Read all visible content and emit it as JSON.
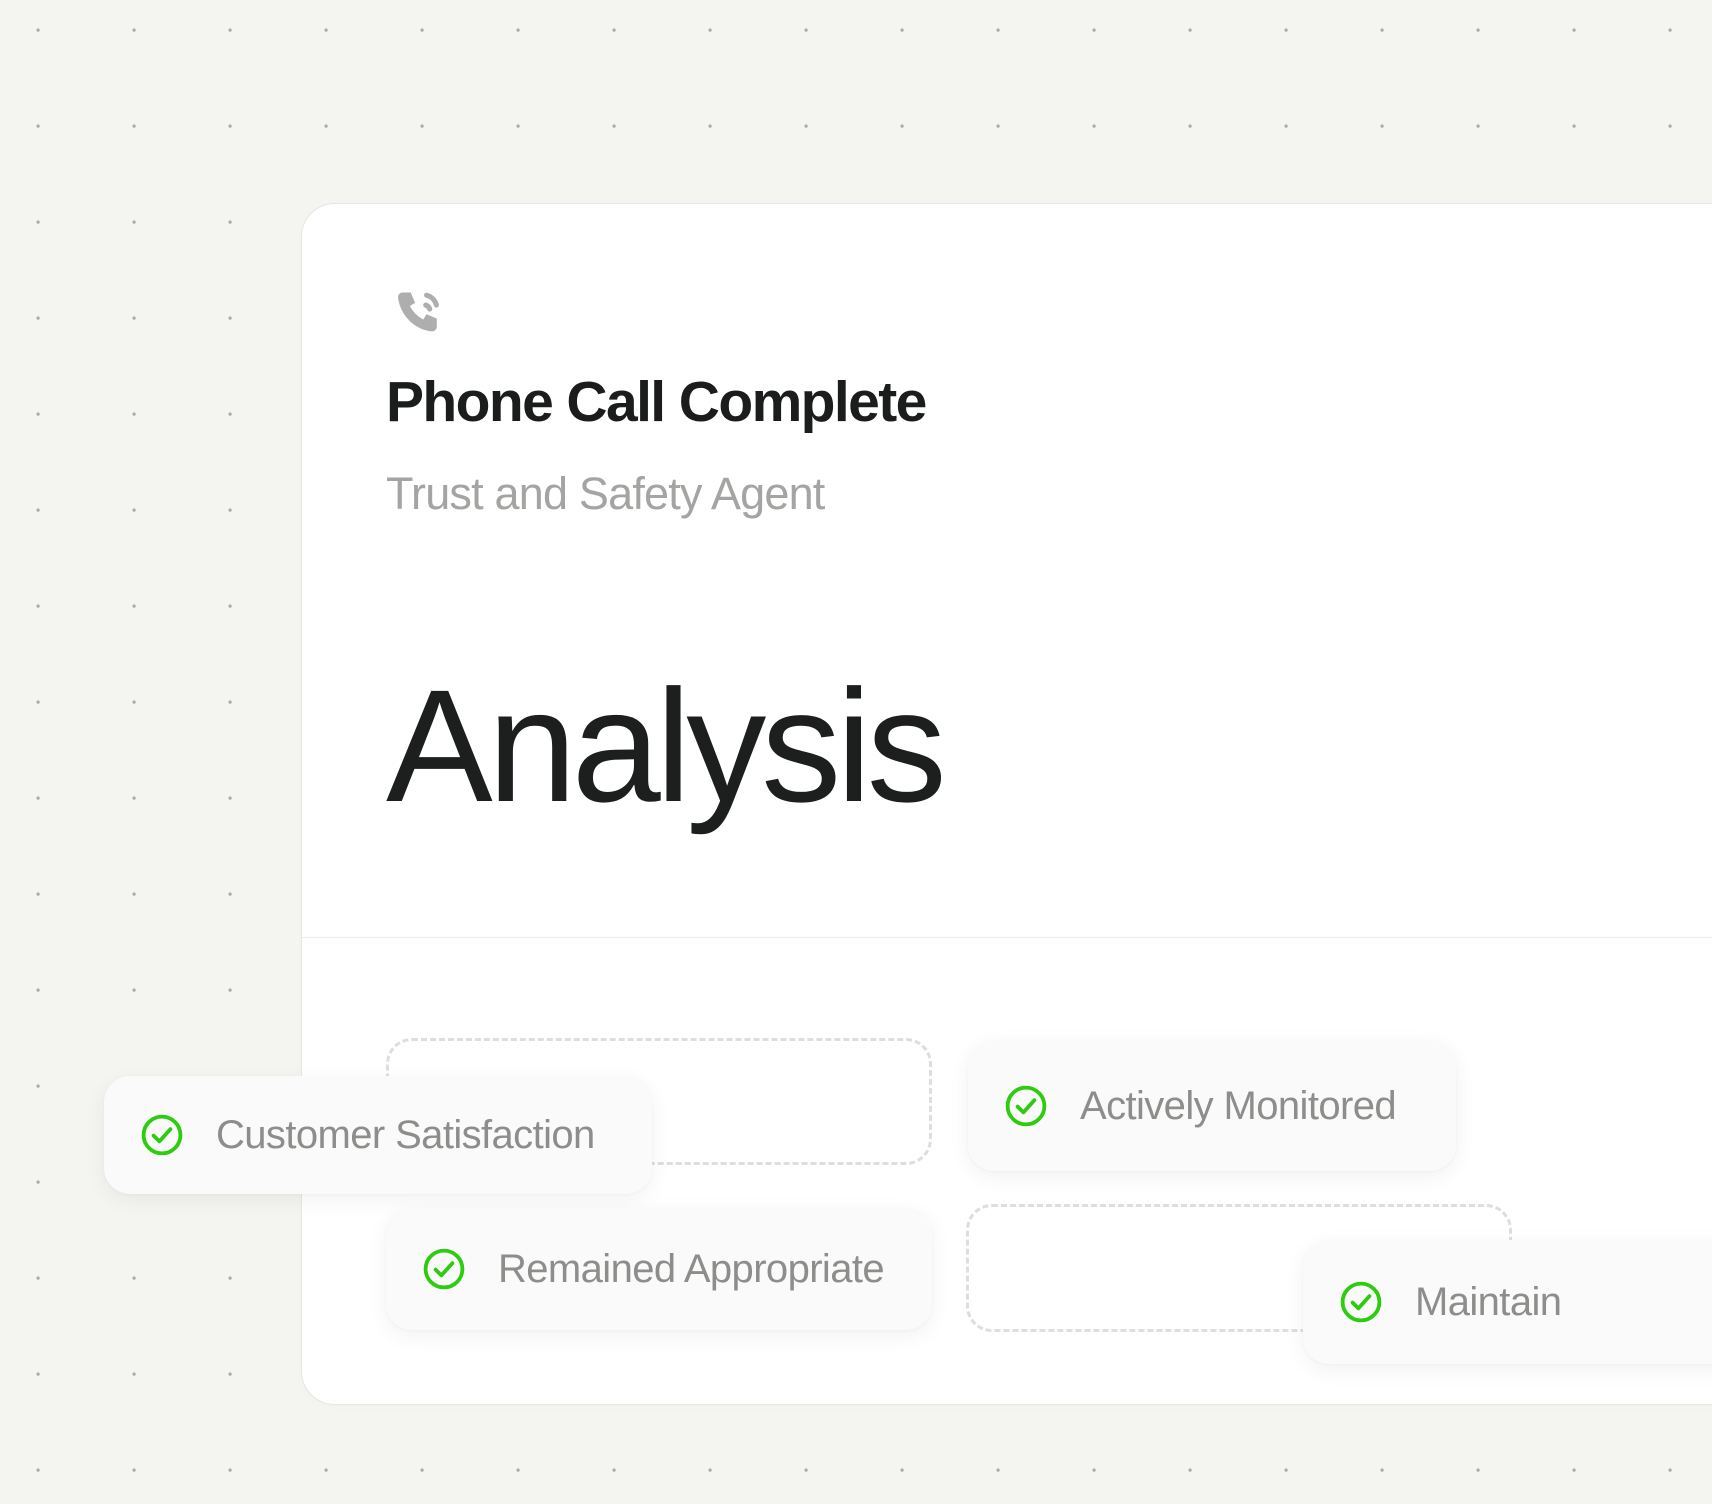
{
  "background": {
    "style": "dot-grid",
    "color": "#f4f4f1",
    "dot_color": "#a9a9a5"
  },
  "card": {
    "icon": "phone-call-outgoing-icon",
    "title": "Phone Call Complete",
    "subtitle": "Trust and Safety Agent",
    "headline": "Analysis",
    "background_color": "#ffffff",
    "border_color": "#e6e6e4"
  },
  "pills": [
    {
      "id": "customer-satisfaction",
      "icon": "circle-check-icon",
      "label": "Customer Satisfaction",
      "accent": "#2ecc0f"
    },
    {
      "id": "actively-monitored",
      "icon": "circle-check-icon",
      "label": "Actively Monitored",
      "accent": "#2ecc0f"
    },
    {
      "id": "remained-appropriate",
      "icon": "circle-check-icon",
      "label": "Remained Appropriate",
      "accent": "#2ecc0f"
    },
    {
      "id": "maintained",
      "icon": "circle-check-icon",
      "label": "Maintain",
      "accent": "#2ecc0f"
    }
  ],
  "placeholders": [
    {
      "id": "slot-one",
      "label": ""
    },
    {
      "id": "slot-two",
      "label": ""
    }
  ]
}
